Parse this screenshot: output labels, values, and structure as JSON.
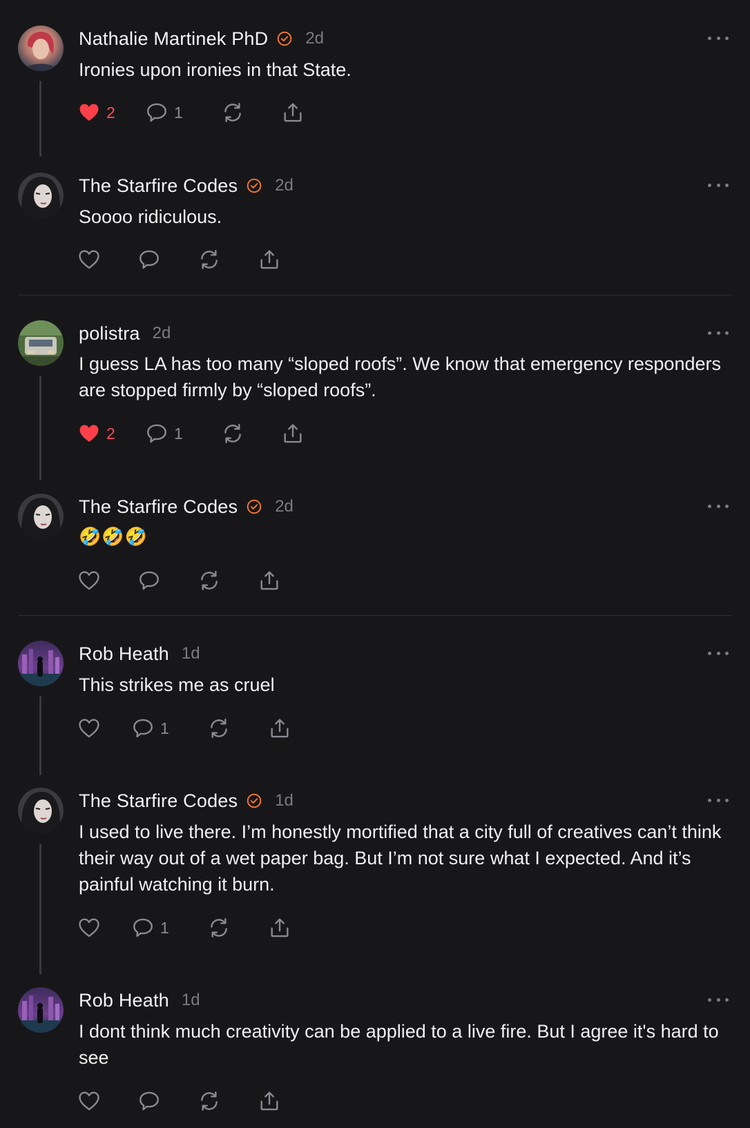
{
  "colors": {
    "background": "#17171a",
    "verified_badge": "#f0752d",
    "like_active": "#ff3f49",
    "muted": "#7b7b80"
  },
  "icons": {
    "like": "heart-icon",
    "comment": "comment-icon",
    "repost": "repost-icon",
    "share": "share-icon",
    "more": "more-horizontal-icon",
    "verified": "verified-badge-icon"
  },
  "posts": [
    {
      "author": "Nathalie Martinek PhD",
      "verified": true,
      "time": "2d",
      "text": "Ironies upon ironies in that State.",
      "likes": "2",
      "liked": true,
      "comments": "1"
    },
    {
      "author": "The Starfire Codes",
      "verified": true,
      "time": "2d",
      "text": "Soooo ridiculous.",
      "likes": "",
      "liked": false,
      "comments": ""
    },
    {
      "author": "polistra",
      "verified": false,
      "time": "2d",
      "text": "I guess LA has too many “sloped roofs”. We know that emergency responders are stopped firmly by “sloped roofs”.",
      "likes": "2",
      "liked": true,
      "comments": "1"
    },
    {
      "author": "The Starfire Codes",
      "verified": true,
      "time": "2d",
      "text": "🤣🤣🤣",
      "likes": "",
      "liked": false,
      "comments": ""
    },
    {
      "author": "Rob Heath",
      "verified": false,
      "time": "1d",
      "text": "This strikes me as cruel",
      "likes": "",
      "liked": false,
      "comments": "1"
    },
    {
      "author": "The Starfire Codes",
      "verified": true,
      "time": "1d",
      "text": "I used to live there. I’m honestly mortified that a city full of creatives can’t think their way out of a wet paper bag. But I’m not sure what I expected. And it’s painful watching it burn.",
      "likes": "",
      "liked": false,
      "comments": "1"
    },
    {
      "author": "Rob Heath",
      "verified": false,
      "time": "1d",
      "text": "I dont think much creativity can be applied to a live fire. But I agree it's hard to see",
      "likes": "",
      "liked": false,
      "comments": ""
    }
  ]
}
